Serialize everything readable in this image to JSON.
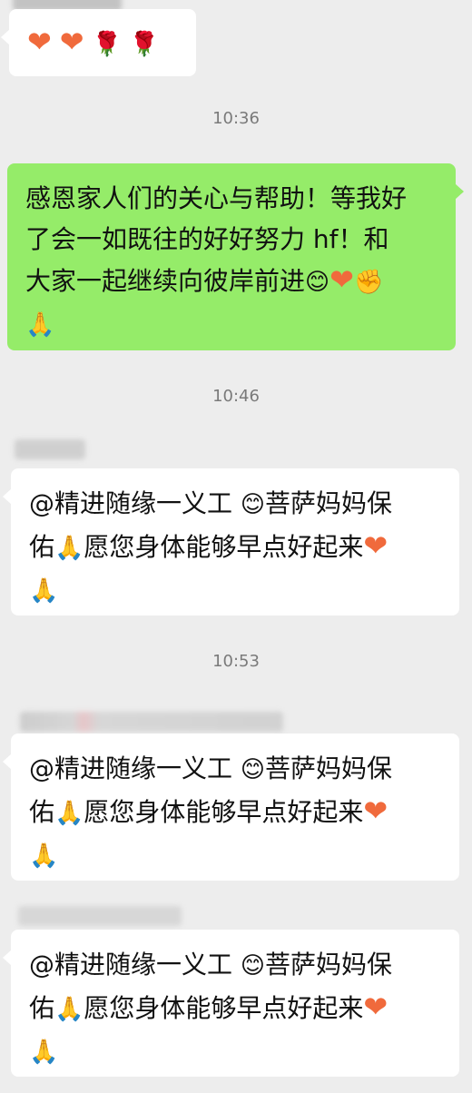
{
  "top_message": {
    "emoji": [
      "❤",
      "❤",
      "🌹",
      "🌹"
    ]
  },
  "times": [
    "10:36",
    "10:46",
    "10:53"
  ],
  "sent_message": {
    "line1": "感恩家人们的关心与帮助！等我好",
    "line2": "了会一如既往的好好努力 hf！和",
    "line3": "大家一起继续向彼岸前进",
    "line3_emoji": [
      "😊",
      "❤",
      "✊"
    ],
    "line4_emoji": "🙏"
  },
  "received_messages": [
    {
      "line1_text": "@精进随缘一义工 ",
      "line1_emoji": "😊",
      "line1_tail": "菩萨妈妈保",
      "line2_head": "佑",
      "line2_emoji": "🙏",
      "line2_text": "愿您身体能够早点好起来",
      "line2_heart": "❤",
      "line3_emoji": "🙏"
    },
    {
      "line1_text": "@精进随缘一义工 ",
      "line1_emoji": "😊",
      "line1_tail": "菩萨妈妈保",
      "line2_head": "佑",
      "line2_emoji": "🙏",
      "line2_text": "愿您身体能够早点好起来",
      "line2_heart": "❤",
      "line3_emoji": "🙏"
    },
    {
      "line1_text": "@精进随缘一义工 ",
      "line1_emoji": "😊",
      "line1_tail": "菩萨妈妈保",
      "line2_head": "佑",
      "line2_emoji": "🙏",
      "line2_text": "愿您身体能够早点好起来",
      "line2_heart": "❤",
      "line3_emoji": "🙏"
    }
  ],
  "colors": {
    "background": "#ededed",
    "sent_bubble": "#95ec69",
    "received_bubble": "#ffffff",
    "time_text": "#7a7a7a",
    "heart": "#f06a3c"
  }
}
